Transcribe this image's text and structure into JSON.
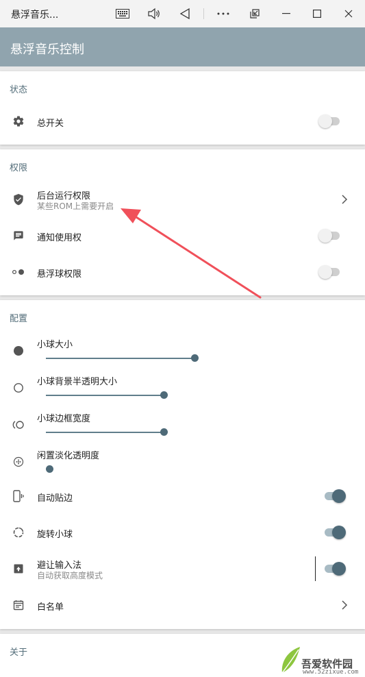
{
  "window": {
    "title": "悬浮音乐..."
  },
  "appbar": {
    "title": "悬浮音乐控制"
  },
  "status": {
    "header": "状态",
    "master_switch": {
      "label": "总开关",
      "on": false
    }
  },
  "permissions": {
    "header": "权限",
    "background": {
      "label": "后台运行权限",
      "subtitle": "某些ROM上需要开启"
    },
    "notification": {
      "label": "通知使用权",
      "on": false
    },
    "float_ball": {
      "label": "悬浮球权限",
      "on": false
    }
  },
  "config": {
    "header": "配置",
    "ball_size": {
      "label": "小球大小",
      "value_fraction": 1.0
    },
    "ball_bg_alpha": {
      "label": "小球背景半透明大小",
      "value_fraction": 0.79
    },
    "ball_border": {
      "label": "小球边框宽度",
      "value_fraction": 0.79
    },
    "idle_fade": {
      "label": "闲置淡化透明度",
      "value_fraction": 0.0
    },
    "auto_edge": {
      "label": "自动贴边",
      "on": true
    },
    "rotate_ball": {
      "label": "旋转小球",
      "on": true
    },
    "avoid_ime": {
      "label": "避让输入法",
      "subtitle": "自动获取高度模式",
      "on": true
    },
    "whitelist": {
      "label": "白名单"
    }
  },
  "about": {
    "header": "关于"
  },
  "watermark": {
    "title": "吾爱软件园",
    "url": "www.52zixue.com"
  },
  "colors": {
    "appbar": "#90a4ae",
    "accent": "#4e6a78",
    "annotation_arrow": "#f0505a"
  }
}
